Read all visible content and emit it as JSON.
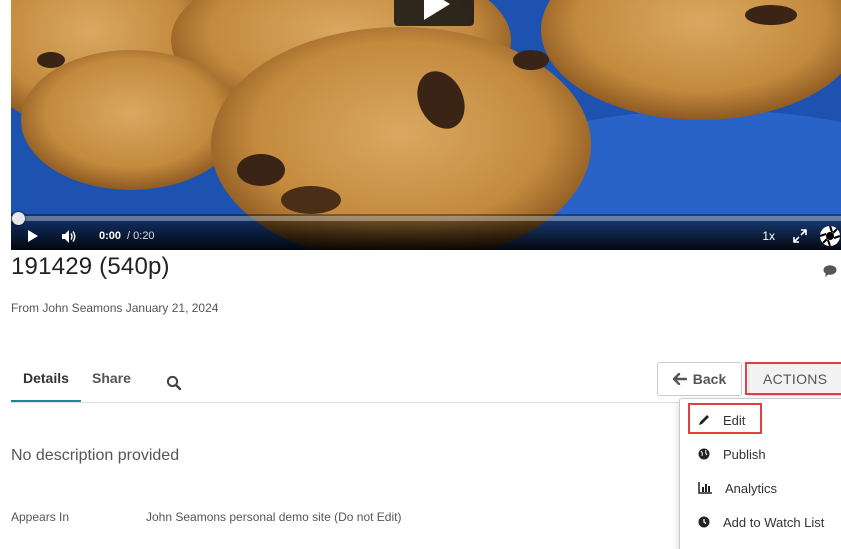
{
  "player": {
    "time_current": "0:00",
    "time_total": "/ 0:20",
    "speed": "1x",
    "progress": 0
  },
  "media": {
    "title": "191429 (540p)",
    "byline": "From John Seamons January 21, 2024"
  },
  "tabs": [
    {
      "label": "Details",
      "active": true
    },
    {
      "label": "Share",
      "active": false
    }
  ],
  "buttons": {
    "back": "Back",
    "actions": "ACTIONS"
  },
  "actions_menu": [
    {
      "label": "Edit",
      "icon": "pencil-icon"
    },
    {
      "label": "Publish",
      "icon": "globe-icon"
    },
    {
      "label": "Analytics",
      "icon": "bar-chart-icon"
    },
    {
      "label": "Add to Watch List",
      "icon": "clock-icon"
    }
  ],
  "details": {
    "description": "No description provided",
    "appears_in_label": "Appears In",
    "appears_in_value": "John Seamons personal demo site (Do not Edit)"
  },
  "colors": {
    "accent": "#1a8c8c",
    "highlight": "#e0403f",
    "plate_blue": "#1c4fa8"
  }
}
